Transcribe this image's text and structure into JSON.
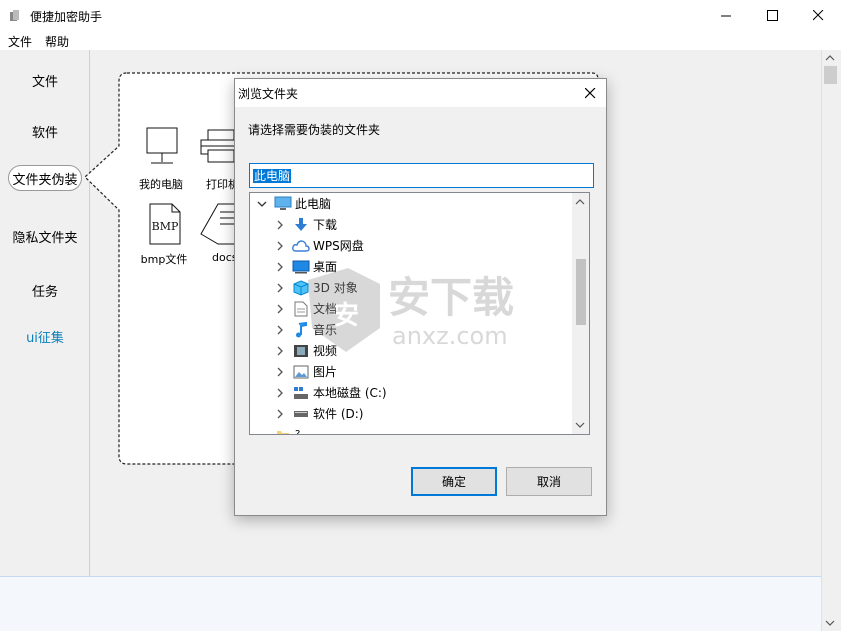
{
  "window": {
    "title": "便捷加密助手"
  },
  "menu": {
    "items": [
      "文件",
      "帮助"
    ]
  },
  "sidebar": {
    "items": [
      {
        "label": "文件"
      },
      {
        "label": "软件"
      },
      {
        "label": "文件夹伪装",
        "selected": true
      },
      {
        "label": "隐私文件夹"
      },
      {
        "label": "任务"
      },
      {
        "label": "ui征集",
        "color": "#0e7fb8"
      }
    ]
  },
  "panel": {
    "tiles": [
      {
        "label": "我的电脑",
        "icon": "computer-icon"
      },
      {
        "label": "打印机",
        "icon": "printer-icon"
      },
      {
        "label": "bmp文件",
        "icon": "bmp-file-icon"
      },
      {
        "label": "docs",
        "icon": "document-icon"
      }
    ]
  },
  "dialog": {
    "title": "浏览文件夹",
    "prompt": "请选择需要伪装的文件夹",
    "path_value": "此电脑",
    "ok_label": "确定",
    "cancel_label": "取消",
    "tree": [
      {
        "label": "此电脑",
        "icon": "computer-icon",
        "expanded": true,
        "level": 0
      },
      {
        "label": "下载",
        "icon": "download-icon",
        "level": 1
      },
      {
        "label": "WPS网盘",
        "icon": "cloud-icon",
        "level": 1
      },
      {
        "label": "桌面",
        "icon": "desktop-icon",
        "level": 1
      },
      {
        "label": "3D 对象",
        "icon": "3d-objects-icon",
        "level": 1
      },
      {
        "label": "文档",
        "icon": "document-icon",
        "level": 1
      },
      {
        "label": "音乐",
        "icon": "music-icon",
        "level": 1
      },
      {
        "label": "视频",
        "icon": "video-icon",
        "level": 1
      },
      {
        "label": "图片",
        "icon": "picture-icon",
        "level": 1
      },
      {
        "label": "本地磁盘 (C:)",
        "icon": "local-disk-icon",
        "level": 1
      },
      {
        "label": "软件 (D:)",
        "icon": "drive-icon",
        "level": 1
      },
      {
        "label": "?",
        "icon": "folder-icon",
        "level": 0
      }
    ]
  },
  "watermark": {
    "text": "安下载",
    "subtext": "anxz.com",
    "badge": "安"
  },
  "colors": {
    "accent": "#0078d7",
    "link": "#0e7fb8"
  }
}
